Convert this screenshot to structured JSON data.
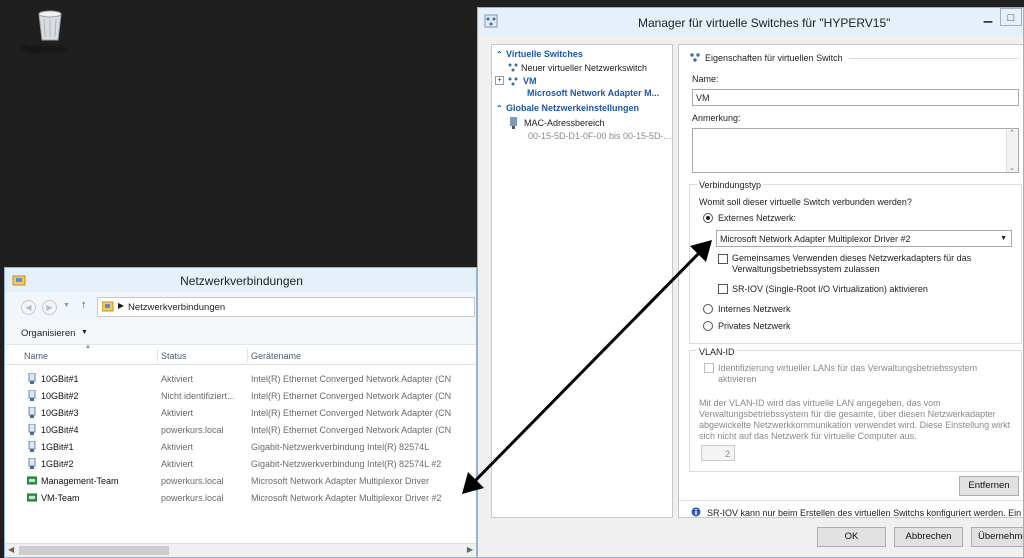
{
  "desktop": {
    "recycle_bin_label": "Papierkorb"
  },
  "network_window": {
    "title": "Netzwerkverbindungen",
    "address_path": "Netzwerkverbindungen",
    "toolbar": {
      "organize": "Organisieren"
    },
    "columns": [
      "Name",
      "Status",
      "Gerätename"
    ],
    "rows": [
      {
        "name": "10GBit#1",
        "status": "Aktiviert",
        "device": "Intel(R) Ethernet Converged Network Adapter (CN"
      },
      {
        "name": "10GBit#2",
        "status": "Nicht identifiziert...",
        "device": "Intel(R) Ethernet Converged Network Adapter (CN"
      },
      {
        "name": "10GBit#3",
        "status": "Aktiviert",
        "device": "Intel(R) Ethernet Converged Network Adapter (CN"
      },
      {
        "name": "10GBit#4",
        "status": "powerkurs.local",
        "device": "Intel(R) Ethernet Converged Network Adapter (CN"
      },
      {
        "name": "1GBit#1",
        "status": "Aktiviert",
        "device": "Gigabit-Netzwerkverbindung Intel(R) 82574L"
      },
      {
        "name": "1GBit#2",
        "status": "Aktiviert",
        "device": "Gigabit-Netzwerkverbindung Intel(R) 82574L #2"
      },
      {
        "name": "Management-Team",
        "status": "powerkurs.local",
        "device": "Microsoft Network Adapter Multiplexor Driver"
      },
      {
        "name": "VM-Team",
        "status": "powerkurs.local",
        "device": "Microsoft Network Adapter Multiplexor Driver #2"
      }
    ]
  },
  "switch_manager": {
    "title": "Manager für virtuelle Switches für \"HYPERV15\"",
    "tree": {
      "virtual_switches_header": "Virtuelle Switches",
      "new_switch": "Neuer virtueller Netzwerkswitch",
      "vm_name": "VM",
      "vm_adapter": "Microsoft Network Adapter M...",
      "global_header": "Globale Netzwerkeinstellungen",
      "mac_label": "MAC-Adressbereich",
      "mac_range": "00-15-5D-D1-0F-00 bis 00-15-5D-..."
    },
    "props": {
      "section_title": "Eigenschaften für virtuellen Switch",
      "name_label": "Name:",
      "name_value": "VM",
      "note_label": "Anmerkung:",
      "conn_type_title": "Verbindungstyp",
      "conn_question": "Womit soll dieser virtuelle Switch verbunden werden?",
      "external": "Externes Netzwerk:",
      "adapter_selected": "Microsoft Network Adapter Multiplexor Driver #2",
      "share_line1": "Gemeinsames Verwenden dieses Netzwerkadapters für das",
      "share_line2": "Verwaltungsbetriebssystem zulassen",
      "sriov": "SR-IOV (Single-Root I/O Virtualization) aktivieren",
      "internal": "Internes Netzwerk",
      "private": "Privates Netzwerk",
      "vlan_title": "VLAN-ID",
      "vlan_check_line1": "Identifizierung virtueller LANs für das Verwaltungsbetriebssystem",
      "vlan_check_line2": "aktivieren",
      "vlan_desc": [
        "Mit der VLAN-ID wird das virtuelle LAN angegeben, das vom",
        "Verwaltungsbetriebssystem für die gesamte, über diesen Netzwerkadapter",
        "abgewickelte Netzwerkkommunikation verwendet wird. Diese Einstellung wirkt",
        "sich nicht auf das Netzwerk für virtuelle Computer aus."
      ],
      "vlan_value": "2",
      "remove_button": "Entfernen",
      "info_text": "SR-IOV kann nur beim Erstellen des virtuellen Switchs konfiguriert werden. Ein"
    },
    "buttons": {
      "ok": "OK",
      "cancel": "Abbrechen",
      "apply": "Übernehmen"
    }
  }
}
